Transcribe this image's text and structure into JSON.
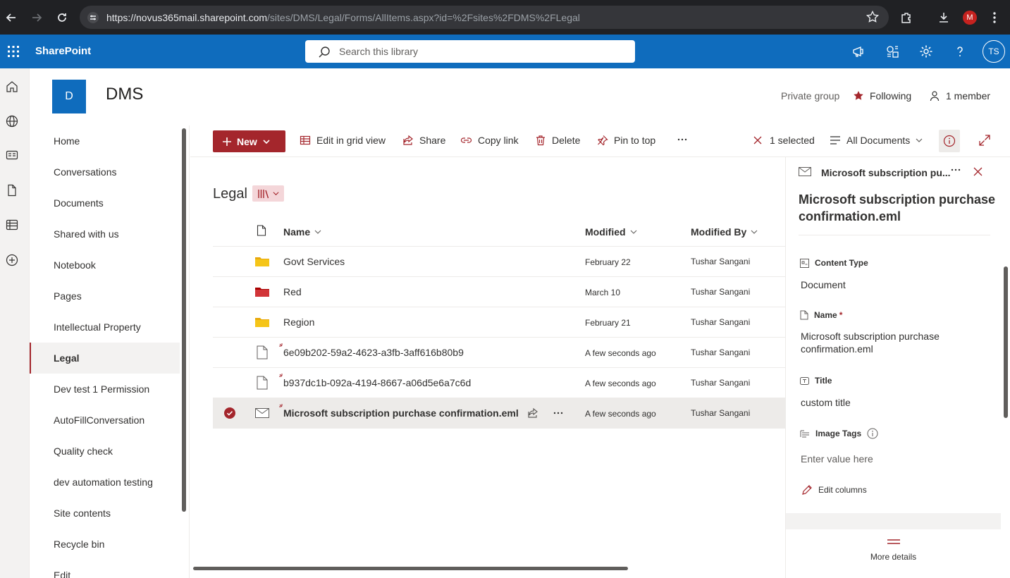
{
  "browser": {
    "url_main": "https://novus365mail.sharepoint.com",
    "url_rest": "/sites/DMS/Legal/Forms/AllItems.aspx?id=%2Fsites%2FDMS%2FLegal",
    "profile_initial": "M"
  },
  "suite": {
    "brand": "SharePoint",
    "search_placeholder": "Search this library",
    "avatar_initials": "TS"
  },
  "site": {
    "logo_letter": "D",
    "title": "DMS",
    "privacy": "Private group",
    "following": "Following",
    "members": "1 member"
  },
  "nav": {
    "items": [
      {
        "label": "Home"
      },
      {
        "label": "Conversations"
      },
      {
        "label": "Documents"
      },
      {
        "label": "Shared with us"
      },
      {
        "label": "Notebook"
      },
      {
        "label": "Pages"
      },
      {
        "label": "Intellectual Property"
      },
      {
        "label": "Legal",
        "active": true
      },
      {
        "label": "Dev test 1 Permission"
      },
      {
        "label": "AutoFillConversation"
      },
      {
        "label": "Quality check"
      },
      {
        "label": "dev automation testing"
      },
      {
        "label": "Site contents"
      },
      {
        "label": "Recycle bin"
      },
      {
        "label": "Edit"
      }
    ]
  },
  "commands": {
    "new": "New",
    "edit_grid": "Edit in grid view",
    "share": "Share",
    "copy_link": "Copy link",
    "delete": "Delete",
    "pin_to_top": "Pin to top",
    "selected": "1 selected",
    "view": "All Documents"
  },
  "library": {
    "title": "Legal",
    "columns": {
      "name": "Name",
      "modified": "Modified",
      "modified_by": "Modified By"
    },
    "rows": [
      {
        "name": "Govt Services",
        "modified": "February 22",
        "by": "Tushar Sangani",
        "type": "folder",
        "color": "#f5c518"
      },
      {
        "name": "Red",
        "modified": "March 10",
        "by": "Tushar Sangani",
        "type": "folder",
        "color": "#d13438"
      },
      {
        "name": "Region",
        "modified": "February 21",
        "by": "Tushar Sangani",
        "type": "folder",
        "color": "#f5c518"
      },
      {
        "name": "6e09b202-59a2-4623-a3fb-3aff616b80b9",
        "modified": "A few seconds ago",
        "by": "Tushar Sangani",
        "type": "file"
      },
      {
        "name": "b937dc1b-092a-4194-8667-a06d5e6a7c6d",
        "modified": "A few seconds ago",
        "by": "Tushar Sangani",
        "type": "file"
      },
      {
        "name": "Microsoft subscription purchase confirmation.eml",
        "modified": "A few seconds ago",
        "by": "Tushar Sangani",
        "type": "email",
        "selected": true
      }
    ]
  },
  "details": {
    "header_title": "Microsoft subscription pu...",
    "file_title": "Microsoft subscription purchase confirmation.eml",
    "content_type_label": "Content Type",
    "content_type_value": "Document",
    "name_label": "Name",
    "name_required": "*",
    "name_value": "Microsoft subscription purchase confirmation.eml",
    "title_label": "Title",
    "title_value": "custom title",
    "image_tags_label": "Image Tags",
    "image_tags_placeholder": "Enter value here",
    "edit_columns": "Edit columns",
    "more_details": "More details"
  },
  "colors": {
    "suite_blue": "#0f6cbd",
    "accent_red": "#a4262c",
    "folder_yellow": "#f5c518",
    "folder_red": "#d13438"
  }
}
